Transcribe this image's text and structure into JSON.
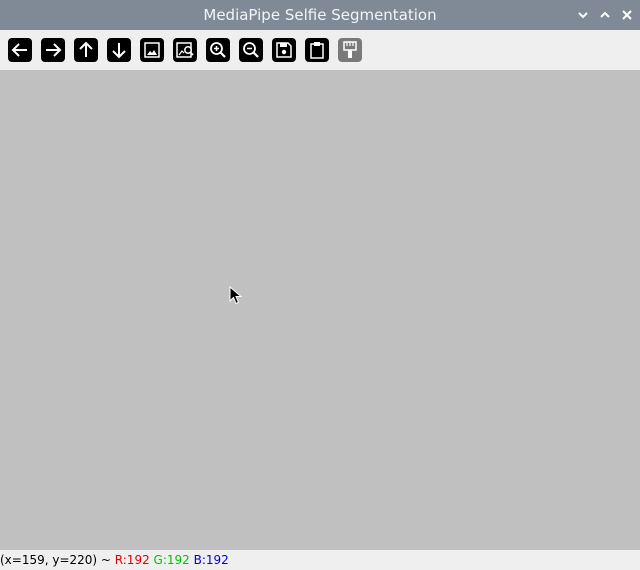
{
  "window": {
    "title": "MediaPipe Selfie Segmentation",
    "controls": [
      "minimize",
      "maximize",
      "close"
    ]
  },
  "toolbar": {
    "buttons": [
      {
        "icon": "arrow-left-icon"
      },
      {
        "icon": "arrow-right-icon"
      },
      {
        "icon": "arrow-up-icon"
      },
      {
        "icon": "arrow-down-icon"
      },
      {
        "icon": "image-icon"
      },
      {
        "icon": "image-zoom-icon"
      },
      {
        "icon": "zoom-in-icon"
      },
      {
        "icon": "zoom-out-icon"
      },
      {
        "icon": "save-icon"
      },
      {
        "icon": "clipboard-icon"
      },
      {
        "icon": "properties-icon",
        "enabled": false
      }
    ]
  },
  "canvas": {
    "color": "#c0c0c0"
  },
  "status": {
    "coords": "(x=159, y=220) ~ ",
    "r": "R:192",
    "g": "G:192",
    "b": "B:192",
    "r_color": "#e00000",
    "g_color": "#00c000",
    "b_color": "#0000e0"
  }
}
